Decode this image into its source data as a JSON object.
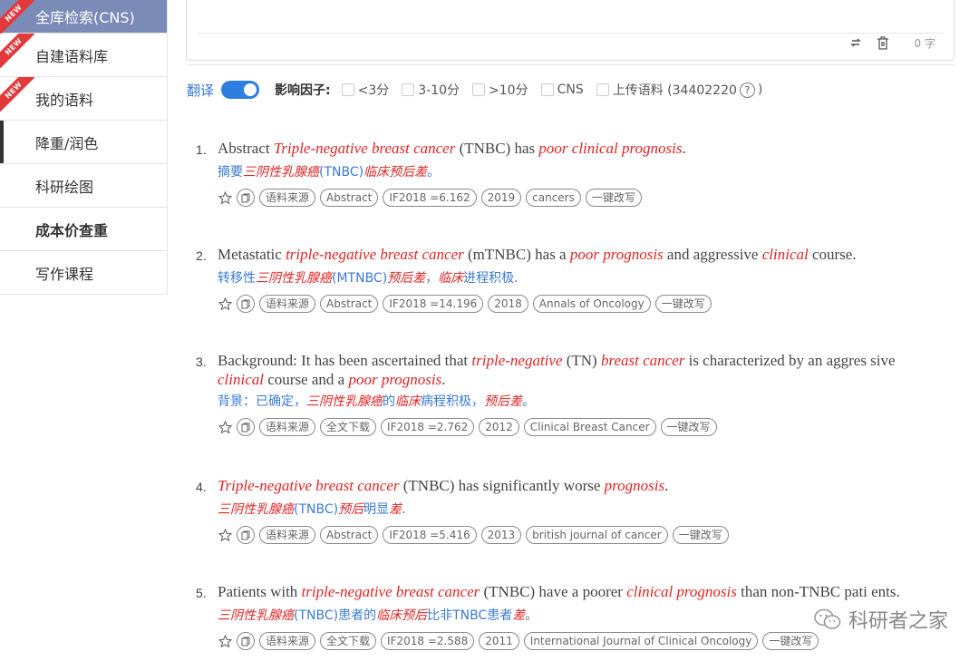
{
  "sidebar": {
    "items": [
      {
        "label": "全库检索(CNS)",
        "badge": "NEW"
      },
      {
        "label": "自建语料库",
        "badge": "NEW"
      },
      {
        "label": "我的语料",
        "badge": "NEW"
      },
      {
        "label": "降重/润色"
      },
      {
        "label": "科研绘图"
      },
      {
        "label": "成本价查重"
      },
      {
        "label": "写作课程"
      }
    ]
  },
  "editor": {
    "word_count": "0 字"
  },
  "filters": {
    "translate_label": "翻译",
    "translate_on": true,
    "impact_label": "影响因子:",
    "options": [
      "<3分",
      "3-10分",
      ">10分",
      "CNS"
    ],
    "upload_label": "上传语料 (34402220",
    "help_icon": "?",
    "upload_suffix": ")"
  },
  "results": [
    {
      "num": "1.",
      "en": [
        {
          "t": "Abstract "
        },
        {
          "t": "Triple-negative breast cancer",
          "em": true
        },
        {
          "t": " (TNBC) has "
        },
        {
          "t": "poor clinical prognosis",
          "em": true
        },
        {
          "t": "."
        }
      ],
      "zh": [
        {
          "t": "摘要"
        },
        {
          "t": "三阴性乳腺癌",
          "hl": true
        },
        {
          "t": "(TNBC)"
        },
        {
          "t": "临床预后差",
          "hl": true
        },
        {
          "t": "。"
        }
      ],
      "tags": [
        "语料来源",
        "Abstract",
        "IF2018 =6.162",
        "2019",
        "cancers",
        "一键改写"
      ]
    },
    {
      "num": "2.",
      "en": [
        {
          "t": "Metastatic "
        },
        {
          "t": "triple-negative breast cancer",
          "em": true
        },
        {
          "t": " (mTNBC) has a "
        },
        {
          "t": "poor prognosis",
          "em": true
        },
        {
          "t": " and aggressive "
        },
        {
          "t": "clinical",
          "em": true
        },
        {
          "t": " course."
        }
      ],
      "zh": [
        {
          "t": "转移性"
        },
        {
          "t": "三阴性乳腺癌",
          "hl": true
        },
        {
          "t": "(MTNBC)"
        },
        {
          "t": "预后差",
          "hl": true
        },
        {
          "t": "，"
        },
        {
          "t": "临床",
          "hl": true
        },
        {
          "t": "进程积极."
        }
      ],
      "tags": [
        "语料来源",
        "Abstract",
        "IF2018 =14.196",
        "2018",
        "Annals of Oncology",
        "一键改写"
      ]
    },
    {
      "num": "3.",
      "en": [
        {
          "t": "Background: It has been ascertained that "
        },
        {
          "t": "triple-negative",
          "em": true
        },
        {
          "t": " (TN) "
        },
        {
          "t": "breast cancer",
          "em": true
        },
        {
          "t": " is characterized by an aggres sive "
        },
        {
          "t": "clinical",
          "em": true
        },
        {
          "t": " course and a "
        },
        {
          "t": "poor prognosis",
          "em": true
        },
        {
          "t": "."
        }
      ],
      "zh": [
        {
          "t": "背景：已确定，"
        },
        {
          "t": "三阴性乳腺癌",
          "hl": true
        },
        {
          "t": "的"
        },
        {
          "t": "临床",
          "hl": true
        },
        {
          "t": "病程积极，"
        },
        {
          "t": "预后差",
          "hl": true
        },
        {
          "t": "。"
        }
      ],
      "tags": [
        "语料来源",
        "全文下载",
        "IF2018 =2.762",
        "2012",
        "Clinical Breast Cancer",
        "一键改写"
      ]
    },
    {
      "num": "4.",
      "en": [
        {
          "t": "Triple-negative breast cancer",
          "em": true
        },
        {
          "t": " (TNBC) has significantly worse "
        },
        {
          "t": "prognosis",
          "em": true
        },
        {
          "t": "."
        }
      ],
      "zh": [
        {
          "t": "三阴性乳腺癌",
          "hl": true
        },
        {
          "t": "(TNBC)"
        },
        {
          "t": "预后",
          "hl": true
        },
        {
          "t": "明显"
        },
        {
          "t": "差",
          "hl": true
        },
        {
          "t": "."
        }
      ],
      "tags": [
        "语料来源",
        "Abstract",
        "IF2018 =5.416",
        "2013",
        "british journal of cancer",
        "一键改写"
      ]
    },
    {
      "num": "5.",
      "en": [
        {
          "t": "Patients with "
        },
        {
          "t": "triple-negative breast cancer",
          "em": true
        },
        {
          "t": " (TNBC) have a poorer "
        },
        {
          "t": "clinical prognosis",
          "em": true
        },
        {
          "t": " than non-TNBC pati ents."
        }
      ],
      "zh": [
        {
          "t": "三阴性乳腺癌",
          "hl": true
        },
        {
          "t": "(TNBC)患者的"
        },
        {
          "t": "临床预后",
          "hl": true
        },
        {
          "t": "比非TNBC患者"
        },
        {
          "t": "差",
          "hl": true
        },
        {
          "t": "。"
        }
      ],
      "tags": [
        "语料来源",
        "全文下载",
        "IF2018 =2.588",
        "2011",
        "International Journal of Clinical Oncology",
        "一键改写"
      ]
    }
  ],
  "watermark": {
    "text": "科研者之家"
  }
}
